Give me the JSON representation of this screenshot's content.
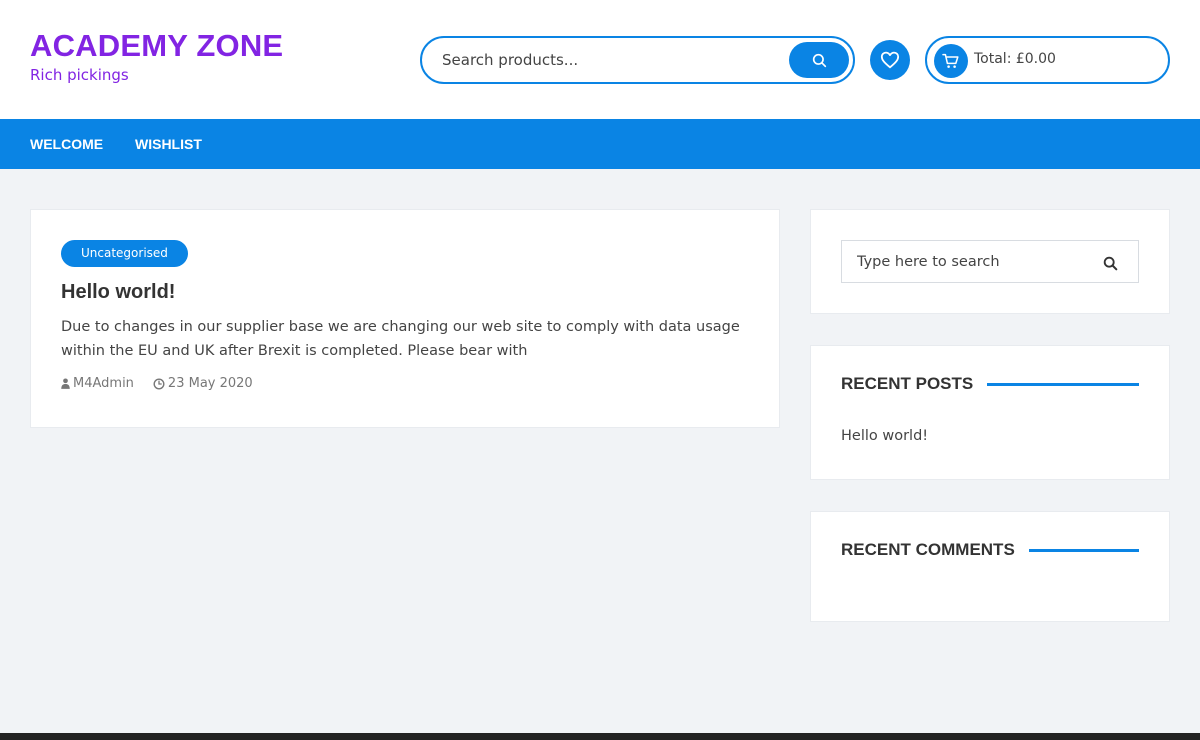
{
  "header": {
    "site_title": "ACADEMY ZONE",
    "tagline": "Rich pickings",
    "search_placeholder": "Search products...",
    "search_icon": "search-icon",
    "wishlist_icon": "heart-icon",
    "cart_icon": "cart-icon",
    "cart_total": "Total: £0.00"
  },
  "nav": {
    "items": [
      {
        "label": "WELCOME"
      },
      {
        "label": "WISHLIST"
      }
    ]
  },
  "post": {
    "category": "Uncategorised",
    "title": "Hello world!",
    "excerpt": "Due to changes in our supplier base we are changing our web site to comply with data usage within the EU and UK after Brexit is completed. Please bear with",
    "author": "M4Admin",
    "date": "23 May 2020"
  },
  "sidebar": {
    "search_placeholder": "Type here to search",
    "recent_posts_title": "RECENT POSTS",
    "recent_posts": [
      "Hello world!"
    ],
    "recent_comments_title": "RECENT COMMENTS"
  },
  "colors": {
    "brand": "#8224e3",
    "accent": "#0a84e4",
    "background": "#f1f3f6",
    "footer": "#222222"
  }
}
